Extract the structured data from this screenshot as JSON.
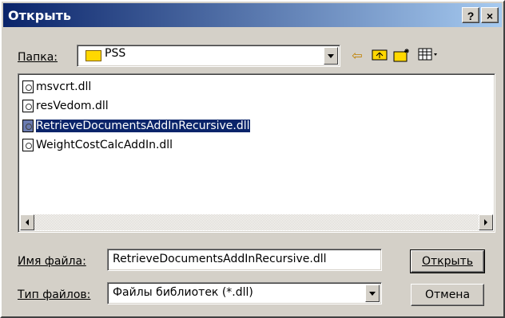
{
  "window": {
    "title": "Открыть",
    "help_glyph": "?",
    "close_glyph": "×"
  },
  "lookin": {
    "label": "Папка:",
    "folder": "PSS"
  },
  "toolbar": {
    "back_icon": "arrow-left-icon",
    "up_icon": "folder-up-icon",
    "newfolder_icon": "new-folder-icon",
    "view_icon": "view-menu-icon"
  },
  "files": [
    {
      "name": "msvcrt.dll",
      "selected": false
    },
    {
      "name": "resVedom.dll",
      "selected": false
    },
    {
      "name": "RetrieveDocumentsAddInRecursive.dll",
      "selected": true
    },
    {
      "name": "WeightCostCalcAddIn.dll",
      "selected": false
    }
  ],
  "filename": {
    "label": "Имя файла:",
    "value": "RetrieveDocumentsAddInRecursive.dll"
  },
  "filetype": {
    "label": "Тип файлов:",
    "value": "Файлы библиотек (*.dll)"
  },
  "buttons": {
    "open": "Открыть",
    "cancel": "Отмена"
  }
}
